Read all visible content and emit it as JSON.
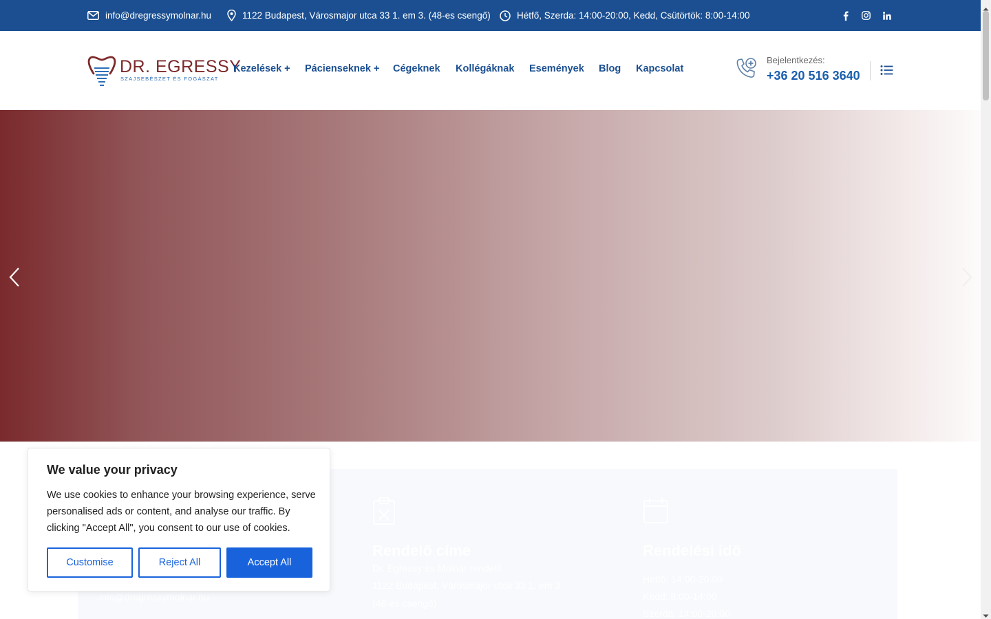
{
  "topbar": {
    "email": "info@dregressymolnar.hu",
    "address": "1122 Budapest, Városmajor utca 33 1. em 3. (48-es csengő)",
    "hours": "Hétfő, Szerda: 14:00-20:00, Kedd, Csütörtök: 8:00-14:00",
    "icons": [
      "envelope-icon",
      "map-pin-icon",
      "clock-icon",
      "facebook-icon",
      "instagram-icon",
      "linkedin-icon"
    ]
  },
  "logo": {
    "name": "DR. EGRESSY",
    "subtitle": "SZAJSEBÉSZET ÉS FOGÁSZAT"
  },
  "nav": {
    "items": [
      {
        "label": "Kezelések +"
      },
      {
        "label": "Páciens­eknek +"
      },
      {
        "label": "Cégeknek"
      },
      {
        "label": "Kollégáknak"
      },
      {
        "label": "Események"
      },
      {
        "label": "Blog"
      },
      {
        "label": "Kapcsolat"
      }
    ]
  },
  "contact": {
    "login_label": "Bejelentkezés:",
    "phone": "+36 20 516 3640"
  },
  "hero": {
    "prev_icon": "chevron-left-icon",
    "next_icon": "chevron-right-icon"
  },
  "info": {
    "col2_title": "Rendelő címe",
    "col2_line1": "Dr. Egressy és Molnár rendelő",
    "col2_line2": "1122 Budapest, Városmajor utca 33 1. em 3.",
    "col2_line3": "(48-es csengő)",
    "col3_title": "Rendelési idő",
    "col3_line1": "Hétfő: 14:00-20:00",
    "col3_line2": "Kedd: 8:00-14:00",
    "col3_line3": "Szerda: 14:00-20:00",
    "col1_line": "info@dregressymolnar.hu"
  },
  "cookie": {
    "title": "We value your privacy",
    "text": "We use cookies to enhance your browsing experience, serve personalised ads or content, and analyse our traffic. By clicking \"Accept All\", you consent to our use of cookies.",
    "customise": "Customise",
    "reject": "Reject All",
    "accept": "Accept All"
  },
  "colors": {
    "topbar": "#1b4f91",
    "nav_text": "#1b4f91",
    "logo_red": "#7d2a2b",
    "button_blue": "#1863dc"
  }
}
